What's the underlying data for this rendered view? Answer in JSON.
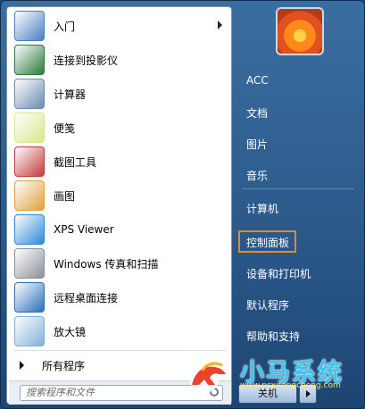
{
  "left_items": [
    {
      "label": "入门",
      "icon": "getting-started-icon",
      "has_arrow": true,
      "color": "#4a7fc2"
    },
    {
      "label": "连接到投影仪",
      "icon": "projector-icon",
      "color": "#2a7a3c"
    },
    {
      "label": "计算器",
      "icon": "calculator-icon",
      "color": "#6c8bb0"
    },
    {
      "label": "便笺",
      "icon": "sticky-notes-icon",
      "color": "#d8e889"
    },
    {
      "label": "截图工具",
      "icon": "snipping-tool-icon",
      "color": "#c23a3a"
    },
    {
      "label": "画图",
      "icon": "paint-icon",
      "color": "#e0a13c"
    },
    {
      "label": "XPS Viewer",
      "icon": "xps-viewer-icon",
      "color": "#2d8ad8"
    },
    {
      "label": "Windows 传真和扫描",
      "icon": "fax-scan-icon",
      "color": "#8a8f98"
    },
    {
      "label": "远程桌面连接",
      "icon": "remote-desktop-icon",
      "color": "#2b6fb8"
    },
    {
      "label": "放大镜",
      "icon": "magnifier-icon",
      "color": "#7fb0d8"
    }
  ],
  "all_programs": "所有程序",
  "search_placeholder": "搜索程序和文件",
  "right_items": [
    "ACC",
    "文档",
    "图片",
    "音乐",
    "计算机",
    "控制面板",
    "设备和打印机",
    "默认程序",
    "帮助和支持"
  ],
  "shutdown_label": "关机",
  "watermark": {
    "text": "小马系统",
    "url": "www.pcxitongcheng.com"
  },
  "colors": {
    "highlight": "#f2861f",
    "menu_blue": "#2b5a8b"
  }
}
